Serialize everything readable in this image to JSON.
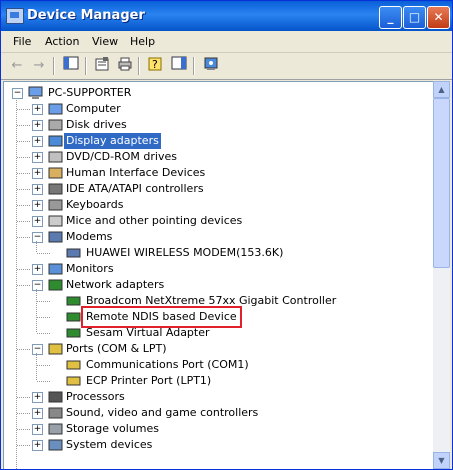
{
  "window": {
    "title": "Device Manager",
    "minimize": "_",
    "maximize": "□",
    "close": "✕"
  },
  "menu": [
    "File",
    "Action",
    "View",
    "Help"
  ],
  "toolbar": {
    "back": "←",
    "forward": "→"
  },
  "tree": {
    "root": "PC-SUPPORTER",
    "categories": [
      {
        "label": "Computer",
        "icon": "computer-icon",
        "expanded": false
      },
      {
        "label": "Disk drives",
        "icon": "disk-icon",
        "expanded": false
      },
      {
        "label": "Display adapters",
        "icon": "display-icon",
        "expanded": false,
        "selected": true
      },
      {
        "label": "DVD/CD-ROM drives",
        "icon": "dvd-icon",
        "expanded": false
      },
      {
        "label": "Human Interface Devices",
        "icon": "hid-icon",
        "expanded": false
      },
      {
        "label": "IDE ATA/ATAPI controllers",
        "icon": "ide-icon",
        "expanded": false
      },
      {
        "label": "Keyboards",
        "icon": "keyboard-icon",
        "expanded": false
      },
      {
        "label": "Mice and other pointing devices",
        "icon": "mouse-icon",
        "expanded": false
      },
      {
        "label": "Modems",
        "icon": "modem-icon",
        "expanded": true,
        "children": [
          {
            "label": "HUAWEI WIRELESS MODEM(153.6K)",
            "icon": "modem-icon"
          }
        ]
      },
      {
        "label": "Monitors",
        "icon": "monitor-icon",
        "expanded": false
      },
      {
        "label": "Network adapters",
        "icon": "network-icon",
        "expanded": true,
        "children": [
          {
            "label": "Broadcom NetXtreme 57xx Gigabit Controller",
            "icon": "network-card-icon"
          },
          {
            "label": "Remote NDIS based Device",
            "icon": "network-card-icon",
            "highlighted": true
          },
          {
            "label": "Sesam Virtual Adapter",
            "icon": "network-card-icon"
          }
        ]
      },
      {
        "label": "Ports (COM & LPT)",
        "icon": "port-icon",
        "expanded": true,
        "children": [
          {
            "label": "Communications Port (COM1)",
            "icon": "port-icon"
          },
          {
            "label": "ECP Printer Port (LPT1)",
            "icon": "port-icon"
          }
        ]
      },
      {
        "label": "Processors",
        "icon": "processor-icon",
        "expanded": false
      },
      {
        "label": "Sound, video and game controllers",
        "icon": "sound-icon",
        "expanded": false
      },
      {
        "label": "Storage volumes",
        "icon": "storage-icon",
        "expanded": false
      },
      {
        "label": "System devices",
        "icon": "system-icon",
        "expanded": false
      }
    ]
  },
  "colors": {
    "selection": "#316ac5",
    "highlight_box": "#e0202a",
    "titlebar": "#0a5fd8"
  }
}
